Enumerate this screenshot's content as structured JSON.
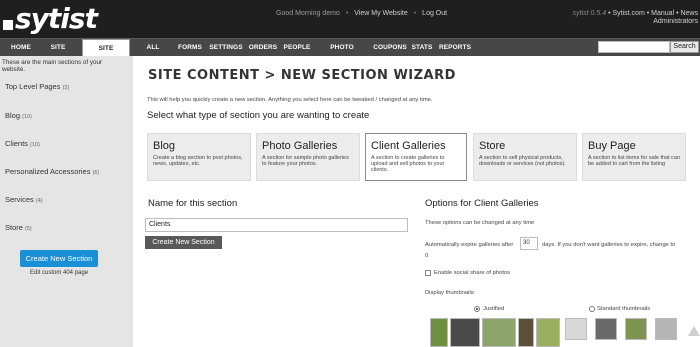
{
  "header": {
    "logo": "sytist",
    "greeting": "Good Morning demo",
    "links": [
      "View My Website",
      "Log Out"
    ],
    "version": "sytist 0.5.4",
    "right_links": [
      "Sytist.com",
      "Manual",
      "News"
    ],
    "role": "Administrators"
  },
  "nav": {
    "items": [
      "HOME",
      "SITE DESIGN",
      "SITE CONTENT",
      "ALL PHOTOS",
      "FORMS",
      "SETTINGS",
      "ORDERS",
      "PEOPLE",
      "PHOTO PRODUCTS",
      "COUPONS",
      "STATS",
      "REPORTS"
    ],
    "active": "SITE CONTENT",
    "search_button": "Search",
    "search_value": ""
  },
  "sidebar": {
    "intro": "These are the main sections of your website.",
    "items": [
      {
        "label": "Top Level Pages",
        "count": "(2)"
      },
      {
        "label": "Blog",
        "count": "(10)"
      },
      {
        "label": "Clients",
        "count": "(10)"
      },
      {
        "label": "Personalized Accessories",
        "count": "(6)"
      },
      {
        "label": "Services",
        "count": "(4)"
      },
      {
        "label": "Store",
        "count": "(5)"
      }
    ],
    "create_button": "Create New Section",
    "edit_404": "Edit custom 404 page"
  },
  "main": {
    "title": "SITE CONTENT > NEW SECTION WIZARD",
    "intro": "This will help you quickly create a new section. Anything you select here can be tweaked / changed at any time.",
    "select_heading": "Select what type of section you are wanting to create",
    "cards": [
      {
        "title": "Blog",
        "desc": "Create a blog section to post photos, news, updates, etc."
      },
      {
        "title": "Photo Galleries",
        "desc": "A section for sample photo galleries to feature your photos."
      },
      {
        "title": "Client Galleries",
        "desc": "A section to create galleries to upload and sell photos to your clients."
      },
      {
        "title": "Store",
        "desc": "A section to sell physical products, downloads or services (not photos)."
      },
      {
        "title": "Buy Page",
        "desc": "A section to list items for sale that can be added to cart from the listing"
      }
    ],
    "selected_card": "Client Galleries",
    "name_heading": "Name for this section",
    "name_value": "Clients",
    "create_section_button": "Create New Section"
  },
  "options": {
    "heading": "Options for Client Galleries",
    "note": "These options can be changed at any time",
    "expire_label_before": "Automatically expire galleries after",
    "expire_days": "30",
    "expire_label_after": "days. If you don't want galleries to expire, change to",
    "expire_zero": "0",
    "social_share": "Enable social share of photos",
    "display_thumbnails": "Display thumbnails:",
    "thumb_options": [
      "Justified",
      "Standard thumbnails"
    ],
    "thumb_selected": "Justified"
  },
  "colors": {
    "header_bg": "#1f1f1f",
    "nav_bg": "#474747",
    "sidebar_bg": "#e5e5e5",
    "accent": "#1a8fd6"
  }
}
